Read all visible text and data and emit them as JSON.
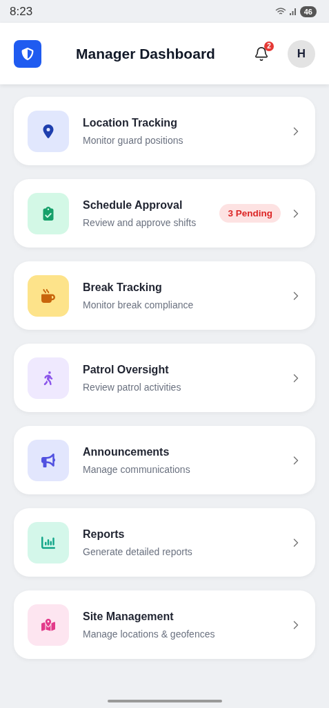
{
  "status_bar": {
    "time": "8:23",
    "battery": "46"
  },
  "header": {
    "title": "Manager Dashboard",
    "notification_count": "2",
    "avatar": "H"
  },
  "menu": [
    {
      "kind": "pin",
      "title": "Location Tracking",
      "subtitle": "Monitor guard positions",
      "color": "#e1e7fd"
    },
    {
      "kind": "clipboard",
      "title": "Schedule Approval",
      "subtitle": "Review and approve shifts",
      "badge": "3 Pending",
      "color": "#d3f8e6"
    },
    {
      "kind": "mug",
      "title": "Break Tracking",
      "subtitle": "Monitor break compliance",
      "color": "#fde38a"
    },
    {
      "kind": "walker",
      "title": "Patrol Oversight",
      "subtitle": "Review patrol activities",
      "color": "#efe9fe"
    },
    {
      "kind": "megaphone",
      "title": "Announcements",
      "subtitle": "Manage communications",
      "color": "#e2e6fd"
    },
    {
      "kind": "chart",
      "title": "Reports",
      "subtitle": "Generate detailed reports",
      "color": "#d4f7ea"
    },
    {
      "kind": "map",
      "title": "Site Management",
      "subtitle": "Manage locations & geofences",
      "color": "#fde5f0"
    }
  ]
}
